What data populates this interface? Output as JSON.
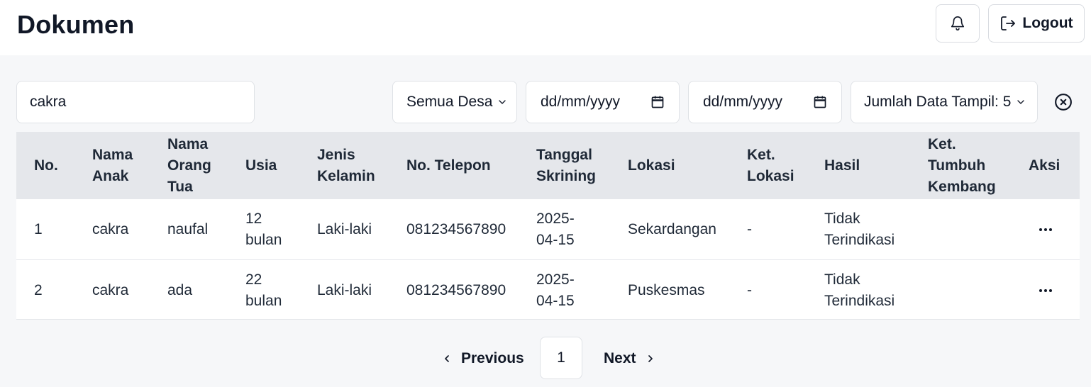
{
  "header": {
    "title": "Dokumen",
    "notification_icon": "bell-icon",
    "logout_label": "Logout",
    "logout_icon": "logout-icon"
  },
  "filters": {
    "search_value": "cakra",
    "desa_selected": "Semua Desa",
    "date_from_placeholder": "dd/mm/yyyy",
    "date_to_placeholder": "dd/mm/yyyy",
    "jumlah_selected": "Jumlah Data Tampil: 5",
    "reset_icon": "close-circle-icon"
  },
  "table": {
    "headers": {
      "no": [
        "No."
      ],
      "nama_anak": [
        "Nama",
        "Anak"
      ],
      "nama_ortu": [
        "Nama",
        "Orang",
        "Tua"
      ],
      "usia": [
        "Usia"
      ],
      "jenis_kelamin": [
        "Jenis",
        "Kelamin"
      ],
      "telepon": [
        "No. Telepon"
      ],
      "tanggal": [
        "Tanggal",
        "Skrining"
      ],
      "lokasi": [
        "Lokasi"
      ],
      "ket_lokasi": [
        "Ket.",
        "Lokasi"
      ],
      "hasil": [
        "Hasil"
      ],
      "ket_tumbuh": [
        "Ket.",
        "Tumbuh",
        "Kembang"
      ],
      "aksi": [
        "Aksi"
      ]
    },
    "rows": [
      {
        "no": "1",
        "nama_anak": "cakra",
        "nama_ortu": "naufal",
        "usia": [
          "12",
          "bulan"
        ],
        "jenis_kelamin": "Laki-laki",
        "telepon": "081234567890",
        "tanggal": [
          "2025-",
          "04-15"
        ],
        "lokasi": "Sekardangan",
        "ket_lokasi": "-",
        "hasil": [
          "Tidak",
          "Terindikasi"
        ],
        "ket_tumbuh": "",
        "aksi_icon": "more-horizontal-icon"
      },
      {
        "no": "2",
        "nama_anak": "cakra",
        "nama_ortu": "ada",
        "usia": [
          "22",
          "bulan"
        ],
        "jenis_kelamin": "Laki-laki",
        "telepon": "081234567890",
        "tanggal": [
          "2025-",
          "04-15"
        ],
        "lokasi": "Puskesmas",
        "ket_lokasi": "-",
        "hasil": [
          "Tidak",
          "Terindikasi"
        ],
        "ket_tumbuh": "",
        "aksi_icon": "more-horizontal-icon"
      }
    ]
  },
  "pagination": {
    "previous_label": "Previous",
    "current_page": "1",
    "next_label": "Next"
  }
}
